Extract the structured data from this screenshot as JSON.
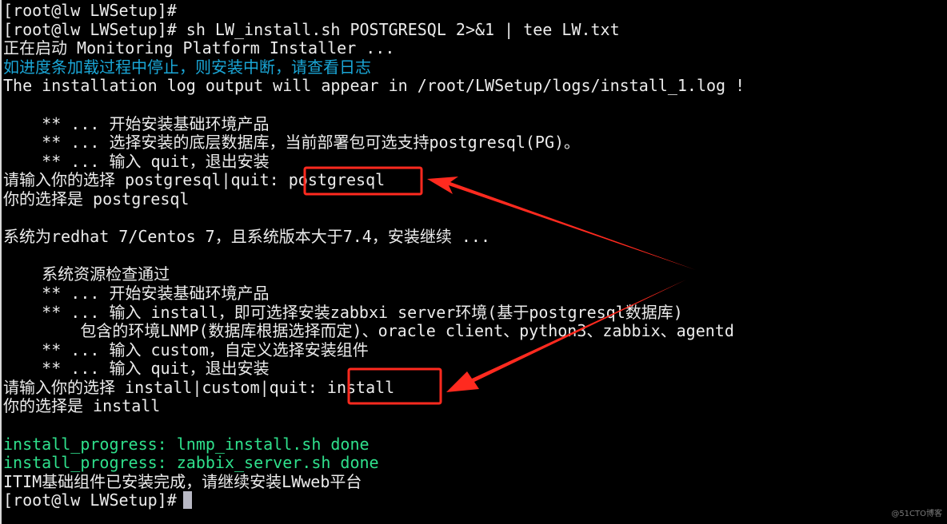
{
  "terminal": {
    "lines": [
      "[root@lw LWSetup]#",
      "[root@lw LWSetup]# sh LW_install.sh POSTGRESQL 2>&1 | tee LW.txt",
      "正在启动 Monitoring Platform Installer ...",
      "如进度条加载过程中停止，则安装中断，请查看日志",
      "The installation log output will appear in /root/LWSetup/logs/install_1.log !",
      "",
      "    ** ... 开始安装基础环境产品",
      "    ** ... 选择安装的底层数据库，当前部署包可选支持postgresql(PG)。",
      "    ** ... 输入 quit，退出安装",
      "请输入你的选择 postgresql|quit: ",
      "你的选择是 postgresql",
      "",
      "系统为redhat 7/Centos 7，且系统版本大于7.4，安装继续 ...",
      "",
      "    系统资源检查通过",
      "    ** ... 开始安装基础环境产品",
      "    ** ... 输入 install，即可选择安装zabbxi server环境(基于postgresql数据库)",
      "        包含的环境LNMP(数据库根据选择而定)、oracle client、python3、zabbix、agentd",
      "    ** ... 输入 custom，自定义选择安装组件",
      "    ** ... 输入 quit，退出安装",
      "请输入你的选择 install|custom|quit: ",
      "你的选择是 install",
      "",
      "install_progress: lnmp_install.sh done",
      "install_progress: zabbix_server.sh done",
      "ITIM基础组件已安装完成，请继续安装LWweb平台",
      "[root@lw LWSetup]#"
    ],
    "input_1": "postgresql",
    "input_2": "install"
  },
  "colors": {
    "background": "#000000",
    "text": "#ececec",
    "cyan": "#1aa6d6",
    "green": "#2fe08c",
    "annotation": "#ff2a1f"
  },
  "watermark": "@51CTO博客"
}
